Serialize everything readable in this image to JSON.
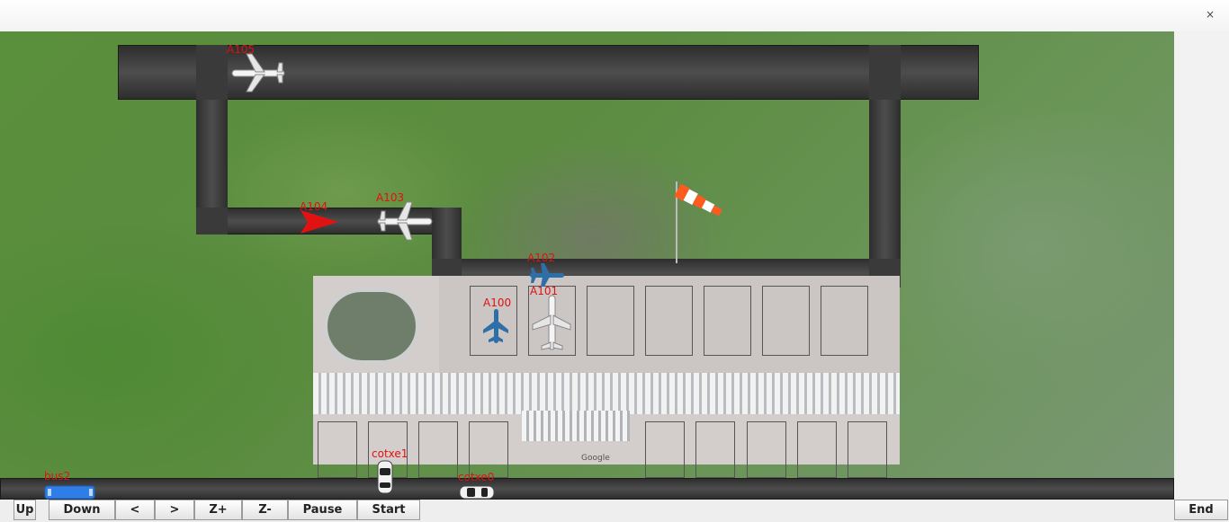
{
  "window": {
    "close_label": "×"
  },
  "aircraft": [
    {
      "label": "A105",
      "icon": "airliner-icon"
    },
    {
      "label": "A104",
      "icon": "red-arrow-icon"
    },
    {
      "label": "A103",
      "icon": "airliner-icon"
    },
    {
      "label": "A102",
      "icon": "fighter-jet-icon"
    },
    {
      "label": "A101",
      "icon": "airliner-icon"
    },
    {
      "label": "A100",
      "icon": "fighter-jet-icon"
    }
  ],
  "vehicles": [
    {
      "label": "bus2",
      "icon": "bus-icon"
    },
    {
      "label": "cotxe1",
      "icon": "car-icon"
    },
    {
      "label": "cotxe0",
      "icon": "car-icon"
    }
  ],
  "terminal": {
    "map_credit": "Google"
  },
  "toolbar": {
    "up": "Up",
    "down": "Down",
    "left": "<",
    "right": ">",
    "zoom_in": "Z+",
    "zoom_out": "Z-",
    "pause": "Pause",
    "start": "Start",
    "end": "End"
  },
  "colors": {
    "label": "#e21010",
    "taxiway": "#3a3a3a",
    "grass": "#5a8f3c"
  }
}
